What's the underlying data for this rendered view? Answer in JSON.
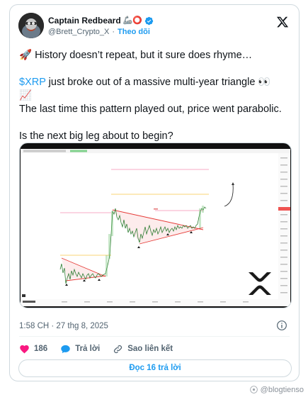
{
  "author": {
    "display_name": "Captain Redbeard",
    "emojis": "🦾⭕",
    "handle": "@Brett_Crypto_X",
    "separator": "·",
    "follow_label": "Theo dõi"
  },
  "tweet": {
    "line1": "🚀 History doesn’t repeat, but it sure does rhyme…",
    "line2_cashtag": "$XRP",
    "line2_rest": " just broke out of a massive multi-year triangle 👀",
    "line3": "📈",
    "line4": "The last time this pattern played out, price went parabolic.",
    "line5": "Is the next big leg about to begin?"
  },
  "chart": {
    "watermark_left": "TradingView"
  },
  "meta": {
    "timestamp": "1:58 CH · 27 thg 8, 2025"
  },
  "actions": {
    "like_count": "186",
    "reply_label": "Trả lời",
    "copy_link_label": "Sao liên kết"
  },
  "read_replies_label": "Đọc 16 trả lời",
  "footer_watermark": "@blogtienso",
  "colors": {
    "accent": "#1d9bf0",
    "like": "#f91880",
    "text": "#0f1419",
    "muted": "#536471",
    "border": "#cfd9de"
  }
}
